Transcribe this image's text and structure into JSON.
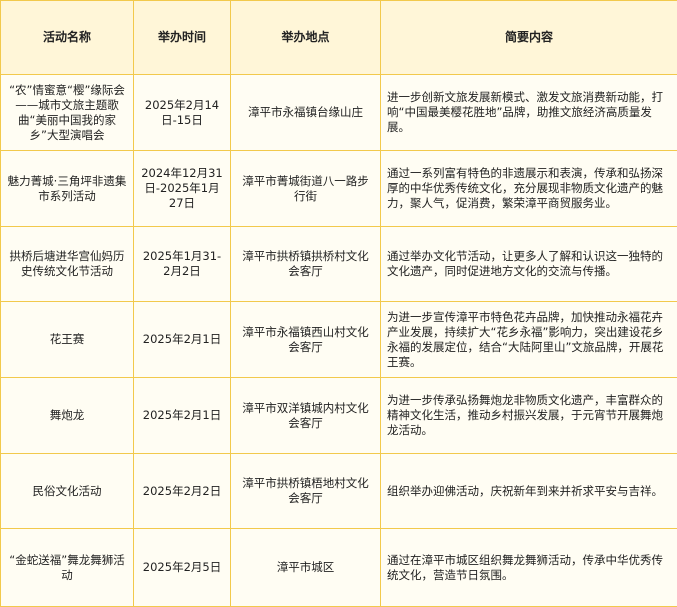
{
  "table": {
    "headers": [
      "活动名称",
      "举办时间",
      "举办地点",
      "简要内容"
    ],
    "rows": [
      {
        "name": "“农”情蜜意“樱”缘际会——城市文旅主题歌曲“美丽中国我的家乡”大型演唱会",
        "time": "2025年2月14日-15日",
        "place": "漳平市永福镇台缘山庄",
        "content": "进一步创新文旅发展新模式、激发文旅消费新动能，打响“中国最美樱花胜地”品牌，助推文旅经济高质量发展。"
      },
      {
        "name": "魅力菁城·三角坪非遗集市系列活动",
        "time": "2024年12月31日-2025年1月27日",
        "place": "漳平市菁城街道八一路步行街",
        "content": "通过一系列富有特色的非遗展示和表演，传承和弘扬深厚的中华优秀传统文化，充分展现非物质文化遗产的魅力，聚人气，促消费，繁荣漳平商贸服务业。"
      },
      {
        "name": "拱桥后塘进华宫仙妈历史传统文化节活动",
        "time": "2025年1月31-2月2日",
        "place": "漳平市拱桥镇拱桥村文化会客厅",
        "content": "通过举办文化节活动，让更多人了解和认识这一独特的文化遗产，同时促进地方文化的交流与传播。"
      },
      {
        "name": "花王赛",
        "time": "2025年2月1日",
        "place": "漳平市永福镇西山村文化会客厅",
        "content": "为进一步宣传漳平市特色花卉品牌，加快推动永福花卉产业发展，持续扩大“花乡永福”影响力，突出建设花乡永福的发展定位，结合“大陆阿里山”文旅品牌，开展花王赛。"
      },
      {
        "name": "舞炮龙",
        "time": "2025年2月1日",
        "place": "漳平市双洋镇城内村文化会客厅",
        "content": "为进一步传承弘扬舞炮龙非物质文化遗产，丰富群众的精神文化生活，推动乡村振兴发展，于元宵节开展舞炮龙活动。"
      },
      {
        "name": "民俗文化活动",
        "time": "2025年2月2日",
        "place": "漳平市拱桥镇梧地村文化会客厅",
        "content": "组织举办迎佛活动，庆祝新年到来并祈求平安与吉祥。"
      },
      {
        "name": "“金蛇送福”舞龙舞狮活动",
        "time": "2025年2月5日",
        "place": "漳平市城区",
        "content": "通过在漳平市城区组织舞龙舞狮活动，传承中华优秀传统文化，营造节日氛围。"
      }
    ]
  }
}
